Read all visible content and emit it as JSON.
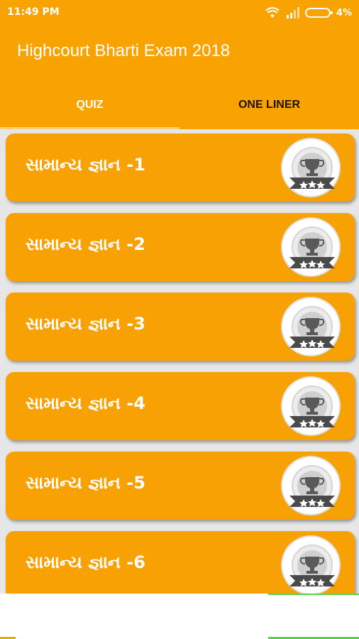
{
  "status_bar": {
    "time": "11:49 PM",
    "battery_percent": "4%",
    "icons": [
      "wifi-icon",
      "signal-icon",
      "battery-icon"
    ]
  },
  "app_bar": {
    "title": "Highcourt Bharti Exam 2018"
  },
  "tabs": [
    {
      "label": "QUIZ",
      "selected": true
    },
    {
      "label": "ONE LINER",
      "selected": false
    }
  ],
  "quiz_list": {
    "items": [
      {
        "label": "સામાન્ય જ્ઞાન -1",
        "icon": "trophy-badge-icon"
      },
      {
        "label": "સામાન્ય જ્ઞાન -2",
        "icon": "trophy-badge-icon"
      },
      {
        "label": "સામાન્ય જ્ઞાન -3",
        "icon": "trophy-badge-icon"
      },
      {
        "label": "સામાન્ય જ્ઞાન -4",
        "icon": "trophy-badge-icon"
      },
      {
        "label": "સામાન્ય જ્ઞાન -5",
        "icon": "trophy-badge-icon"
      },
      {
        "label": "સામાન્ય જ્ઞાન -6",
        "icon": "trophy-badge-icon"
      }
    ]
  },
  "colors": {
    "primary": "#f9a302",
    "card": "#f7a104",
    "list_background": "#e6e6e6",
    "text_on_primary": "#ffffff"
  }
}
